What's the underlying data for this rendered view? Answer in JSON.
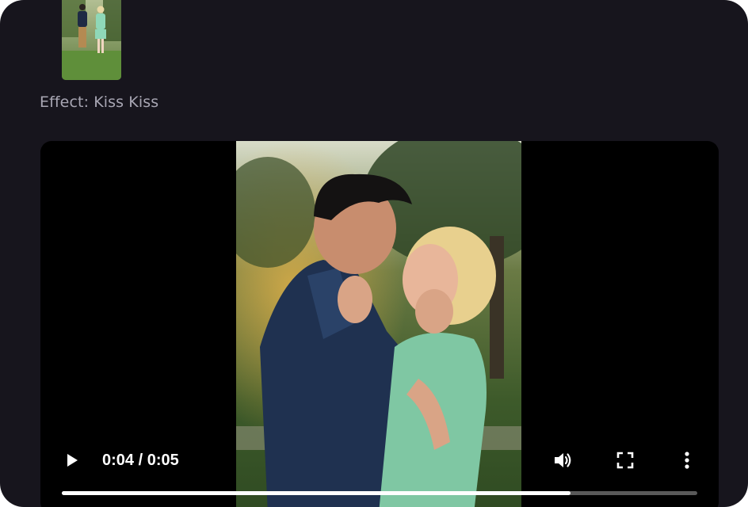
{
  "thumbnail": {
    "icon": "couple-standing-photo"
  },
  "effect": {
    "label": "Effect: Kiss Kiss"
  },
  "player": {
    "time_display": "0:04 / 0:05",
    "progress": 0.8,
    "icons": {
      "play": "play-icon",
      "volume": "volume-icon",
      "fullscreen": "fullscreen-icon",
      "more": "more-vertical-icon"
    }
  },
  "colors": {
    "panel_bg": "#17151d",
    "label_text": "#a8a6b3",
    "player_bg": "#000000",
    "control_fg": "#ffffff"
  }
}
